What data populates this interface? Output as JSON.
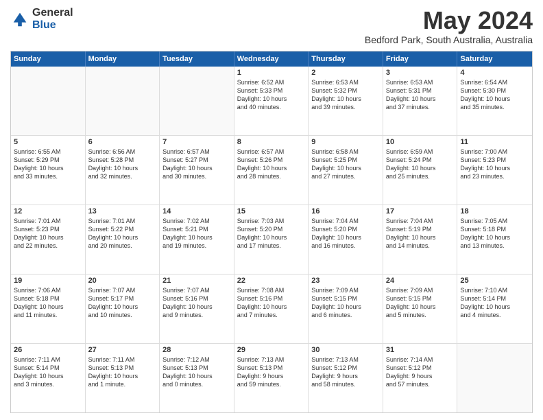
{
  "logo": {
    "general": "General",
    "blue": "Blue"
  },
  "title": "May 2024",
  "location": "Bedford Park, South Australia, Australia",
  "days": [
    "Sunday",
    "Monday",
    "Tuesday",
    "Wednesday",
    "Thursday",
    "Friday",
    "Saturday"
  ],
  "weeks": [
    [
      {
        "day": "",
        "content": ""
      },
      {
        "day": "",
        "content": ""
      },
      {
        "day": "",
        "content": ""
      },
      {
        "day": "1",
        "content": "Sunrise: 6:52 AM\nSunset: 5:33 PM\nDaylight: 10 hours\nand 40 minutes."
      },
      {
        "day": "2",
        "content": "Sunrise: 6:53 AM\nSunset: 5:32 PM\nDaylight: 10 hours\nand 39 minutes."
      },
      {
        "day": "3",
        "content": "Sunrise: 6:53 AM\nSunset: 5:31 PM\nDaylight: 10 hours\nand 37 minutes."
      },
      {
        "day": "4",
        "content": "Sunrise: 6:54 AM\nSunset: 5:30 PM\nDaylight: 10 hours\nand 35 minutes."
      }
    ],
    [
      {
        "day": "5",
        "content": "Sunrise: 6:55 AM\nSunset: 5:29 PM\nDaylight: 10 hours\nand 33 minutes."
      },
      {
        "day": "6",
        "content": "Sunrise: 6:56 AM\nSunset: 5:28 PM\nDaylight: 10 hours\nand 32 minutes."
      },
      {
        "day": "7",
        "content": "Sunrise: 6:57 AM\nSunset: 5:27 PM\nDaylight: 10 hours\nand 30 minutes."
      },
      {
        "day": "8",
        "content": "Sunrise: 6:57 AM\nSunset: 5:26 PM\nDaylight: 10 hours\nand 28 minutes."
      },
      {
        "day": "9",
        "content": "Sunrise: 6:58 AM\nSunset: 5:25 PM\nDaylight: 10 hours\nand 27 minutes."
      },
      {
        "day": "10",
        "content": "Sunrise: 6:59 AM\nSunset: 5:24 PM\nDaylight: 10 hours\nand 25 minutes."
      },
      {
        "day": "11",
        "content": "Sunrise: 7:00 AM\nSunset: 5:23 PM\nDaylight: 10 hours\nand 23 minutes."
      }
    ],
    [
      {
        "day": "12",
        "content": "Sunrise: 7:01 AM\nSunset: 5:23 PM\nDaylight: 10 hours\nand 22 minutes."
      },
      {
        "day": "13",
        "content": "Sunrise: 7:01 AM\nSunset: 5:22 PM\nDaylight: 10 hours\nand 20 minutes."
      },
      {
        "day": "14",
        "content": "Sunrise: 7:02 AM\nSunset: 5:21 PM\nDaylight: 10 hours\nand 19 minutes."
      },
      {
        "day": "15",
        "content": "Sunrise: 7:03 AM\nSunset: 5:20 PM\nDaylight: 10 hours\nand 17 minutes."
      },
      {
        "day": "16",
        "content": "Sunrise: 7:04 AM\nSunset: 5:20 PM\nDaylight: 10 hours\nand 16 minutes."
      },
      {
        "day": "17",
        "content": "Sunrise: 7:04 AM\nSunset: 5:19 PM\nDaylight: 10 hours\nand 14 minutes."
      },
      {
        "day": "18",
        "content": "Sunrise: 7:05 AM\nSunset: 5:18 PM\nDaylight: 10 hours\nand 13 minutes."
      }
    ],
    [
      {
        "day": "19",
        "content": "Sunrise: 7:06 AM\nSunset: 5:18 PM\nDaylight: 10 hours\nand 11 minutes."
      },
      {
        "day": "20",
        "content": "Sunrise: 7:07 AM\nSunset: 5:17 PM\nDaylight: 10 hours\nand 10 minutes."
      },
      {
        "day": "21",
        "content": "Sunrise: 7:07 AM\nSunset: 5:16 PM\nDaylight: 10 hours\nand 9 minutes."
      },
      {
        "day": "22",
        "content": "Sunrise: 7:08 AM\nSunset: 5:16 PM\nDaylight: 10 hours\nand 7 minutes."
      },
      {
        "day": "23",
        "content": "Sunrise: 7:09 AM\nSunset: 5:15 PM\nDaylight: 10 hours\nand 6 minutes."
      },
      {
        "day": "24",
        "content": "Sunrise: 7:09 AM\nSunset: 5:15 PM\nDaylight: 10 hours\nand 5 minutes."
      },
      {
        "day": "25",
        "content": "Sunrise: 7:10 AM\nSunset: 5:14 PM\nDaylight: 10 hours\nand 4 minutes."
      }
    ],
    [
      {
        "day": "26",
        "content": "Sunrise: 7:11 AM\nSunset: 5:14 PM\nDaylight: 10 hours\nand 3 minutes."
      },
      {
        "day": "27",
        "content": "Sunrise: 7:11 AM\nSunset: 5:13 PM\nDaylight: 10 hours\nand 1 minute."
      },
      {
        "day": "28",
        "content": "Sunrise: 7:12 AM\nSunset: 5:13 PM\nDaylight: 10 hours\nand 0 minutes."
      },
      {
        "day": "29",
        "content": "Sunrise: 7:13 AM\nSunset: 5:13 PM\nDaylight: 9 hours\nand 59 minutes."
      },
      {
        "day": "30",
        "content": "Sunrise: 7:13 AM\nSunset: 5:12 PM\nDaylight: 9 hours\nand 58 minutes."
      },
      {
        "day": "31",
        "content": "Sunrise: 7:14 AM\nSunset: 5:12 PM\nDaylight: 9 hours\nand 57 minutes."
      },
      {
        "day": "",
        "content": ""
      }
    ]
  ]
}
